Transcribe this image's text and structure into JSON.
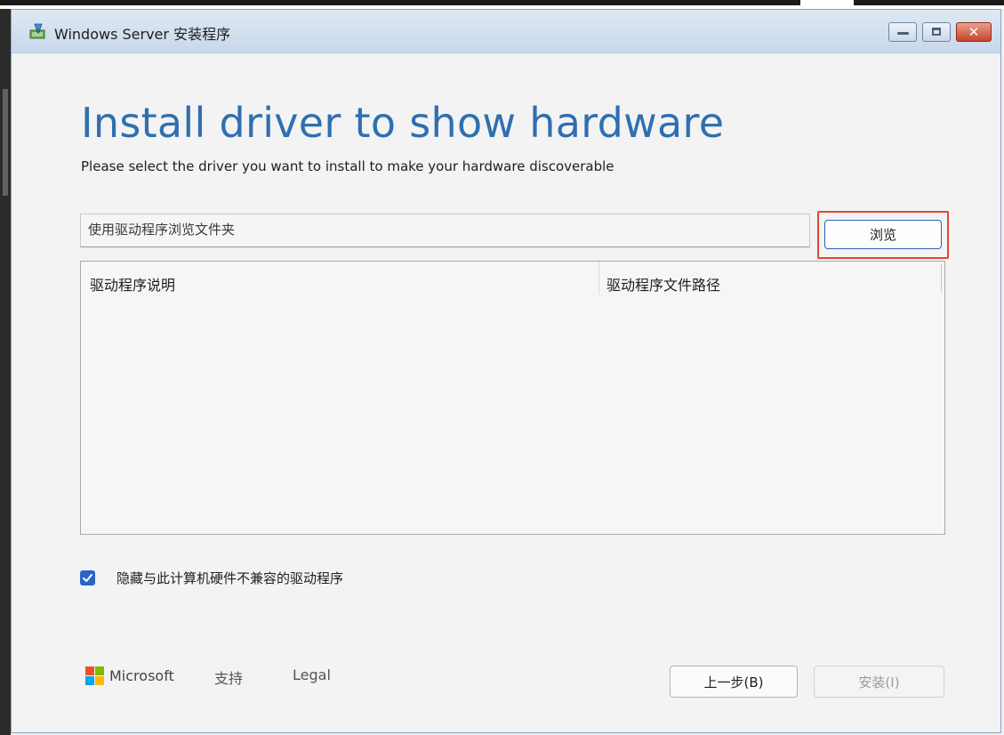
{
  "window": {
    "title": "Windows Server 安装程序"
  },
  "main": {
    "heading": "Install driver to show hardware",
    "subtitle": "Please select the driver you want to install to make your hardware discoverable",
    "folder_field_text": "使用驱动程序浏览文件夹",
    "browse_label": "浏览",
    "table": {
      "columns": [
        "驱动程序说明",
        "驱动程序文件路径"
      ],
      "rows": []
    },
    "hide_incompatible": {
      "label": "隐藏与此计算机硬件不兼容的驱动程序",
      "checked": true
    }
  },
  "footer": {
    "brand": "Microsoft",
    "support_label": "支持",
    "legal_label": "Legal",
    "back_label": "上一步(B)",
    "install_label": "安装(I)"
  },
  "colors": {
    "heading": "#2f6fb0",
    "checkbox": "#2a64c4",
    "highlight": "#e04636",
    "ms_red": "#f25022",
    "ms_green": "#7fba00",
    "ms_blue": "#00a4ef",
    "ms_yellow": "#ffb900"
  }
}
